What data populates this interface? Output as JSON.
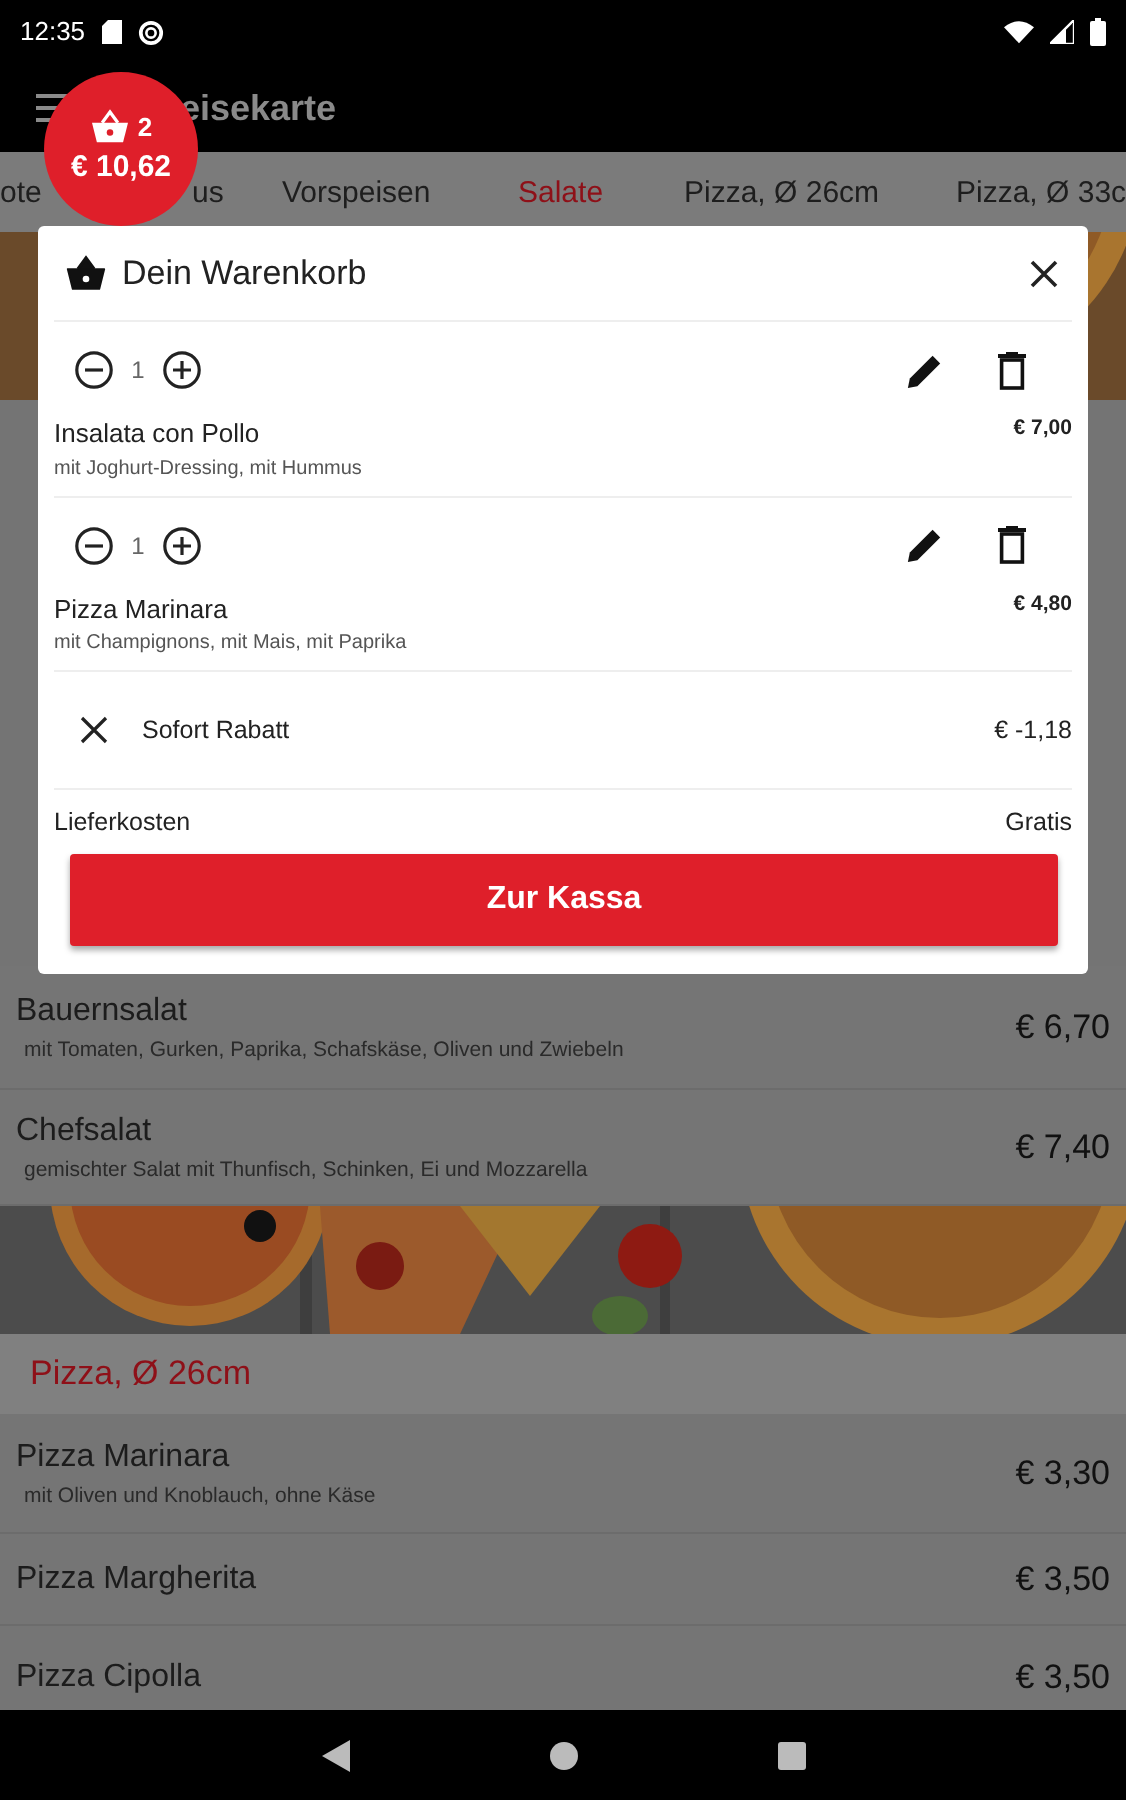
{
  "status_bar": {
    "time": "12:35"
  },
  "app_bar": {
    "title": "eisekarte"
  },
  "cart_badge": {
    "count": "2",
    "total": "€ 10,62"
  },
  "tabs": [
    {
      "label": "ote",
      "selected": false
    },
    {
      "label": "us",
      "selected": false
    },
    {
      "label": "Vorspeisen",
      "selected": false
    },
    {
      "label": "Salate",
      "selected": true
    },
    {
      "label": "Pizza, Ø 26cm",
      "selected": false
    },
    {
      "label": "Pizza, Ø 33c",
      "selected": false
    }
  ],
  "menu": [
    {
      "kind": "picture"
    },
    {
      "kind": "item",
      "name": "Bauernsalat",
      "description": "mit Tomaten, Gurken, Paprika, Schafskäse, Oliven und Zwiebeln",
      "price": "€ 6,70"
    },
    {
      "kind": "item",
      "name": "Chefsalat",
      "description": "gemischter Salat mit Thunfisch, Schinken, Ei und Mozzarella",
      "price": "€ 7,40"
    },
    {
      "kind": "picture"
    },
    {
      "kind": "section",
      "title": "Pizza, Ø 26cm"
    },
    {
      "kind": "item",
      "name": "Pizza Marinara",
      "description": "mit Oliven und Knoblauch, ohne Käse",
      "price": "€ 3,30"
    },
    {
      "kind": "item",
      "name": "Pizza Margherita",
      "price": "€ 3,50"
    },
    {
      "kind": "item",
      "name": "Pizza Cipolla",
      "price": "€ 3,50"
    }
  ],
  "cart_dialog": {
    "title": "Dein Warenkorb",
    "items": [
      {
        "quantity": "1",
        "name": "Insalata con Pollo",
        "options": "mit Joghurt-Dressing, mit Hummus",
        "price": "€ 7,00"
      },
      {
        "quantity": "1",
        "name": "Pizza Marinara",
        "options": "mit Champignons, mit Mais, mit Paprika",
        "price": "€ 4,80"
      }
    ],
    "discount": {
      "label": "Sofort Rabatt",
      "amount": "€ -1,18"
    },
    "delivery": {
      "label": "Lieferkosten",
      "value": "Gratis"
    },
    "checkout_button": "Zur Kassa"
  }
}
